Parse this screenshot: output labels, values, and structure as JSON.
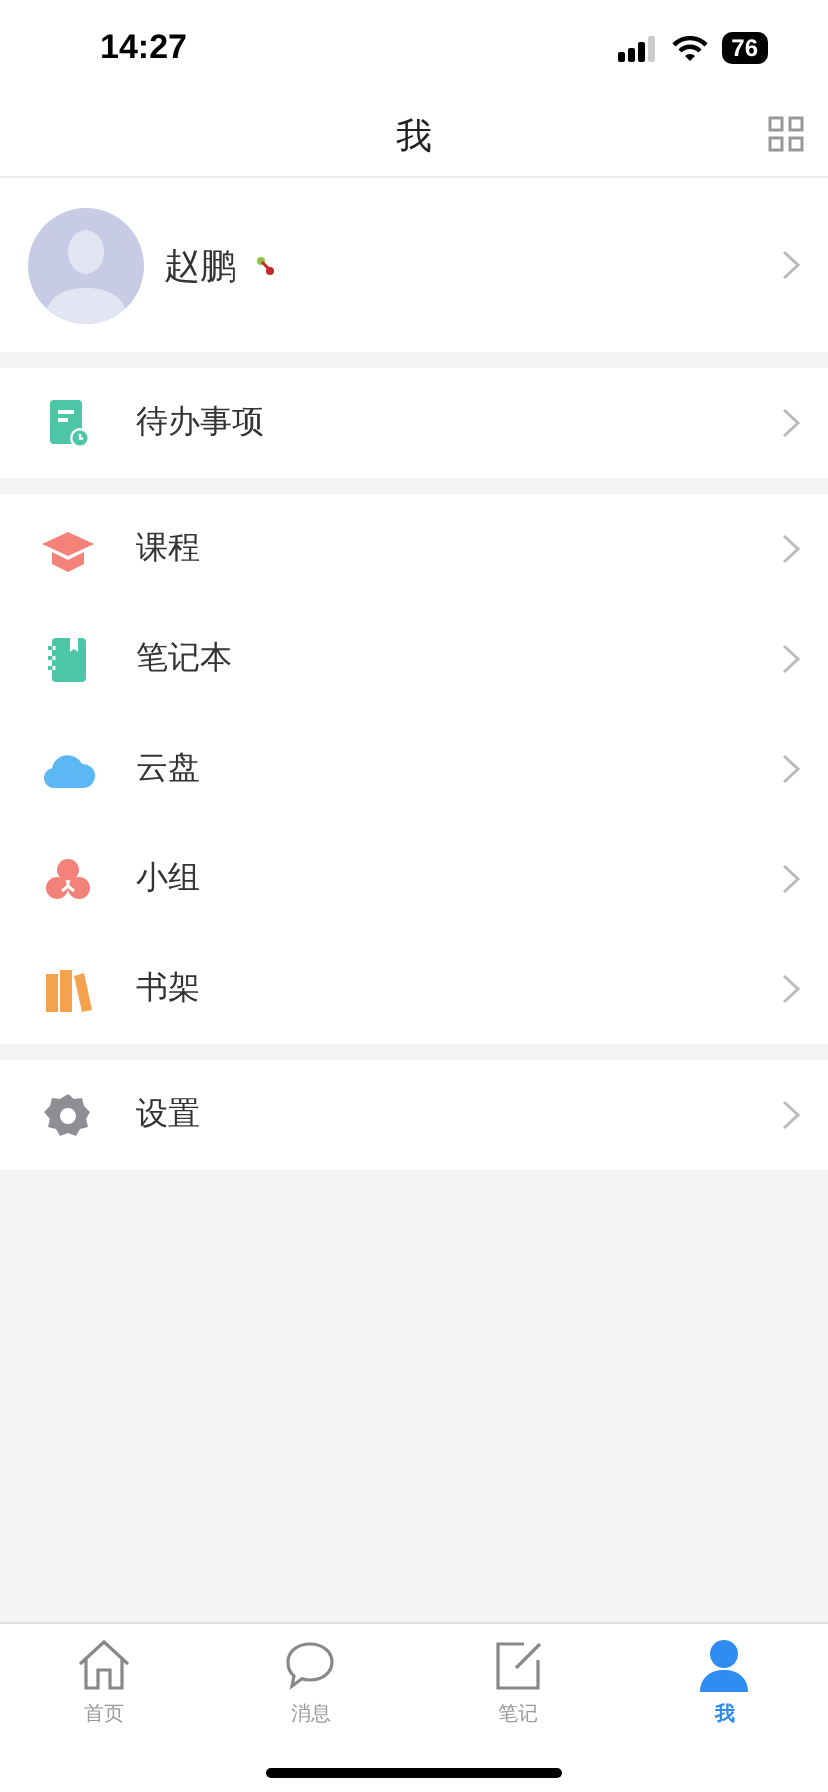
{
  "status_bar": {
    "time": "14:27",
    "battery": "76"
  },
  "header": {
    "title": "我"
  },
  "profile": {
    "name": "赵鹏"
  },
  "sections": [
    {
      "items": [
        {
          "kind": "todo",
          "label": "待办事项"
        }
      ]
    },
    {
      "items": [
        {
          "kind": "course",
          "label": "课程"
        },
        {
          "kind": "notebook",
          "label": "笔记本"
        },
        {
          "kind": "cloud",
          "label": "云盘"
        },
        {
          "kind": "group",
          "label": "小组"
        },
        {
          "kind": "bookshelf",
          "label": "书架"
        }
      ]
    },
    {
      "items": [
        {
          "kind": "settings",
          "label": "设置"
        }
      ]
    }
  ],
  "tab_bar": [
    {
      "kind": "home",
      "label": "首页",
      "selected": false
    },
    {
      "kind": "message",
      "label": "消息",
      "selected": false
    },
    {
      "kind": "note",
      "label": "笔记",
      "selected": false
    },
    {
      "kind": "me",
      "label": "我",
      "selected": true
    }
  ]
}
